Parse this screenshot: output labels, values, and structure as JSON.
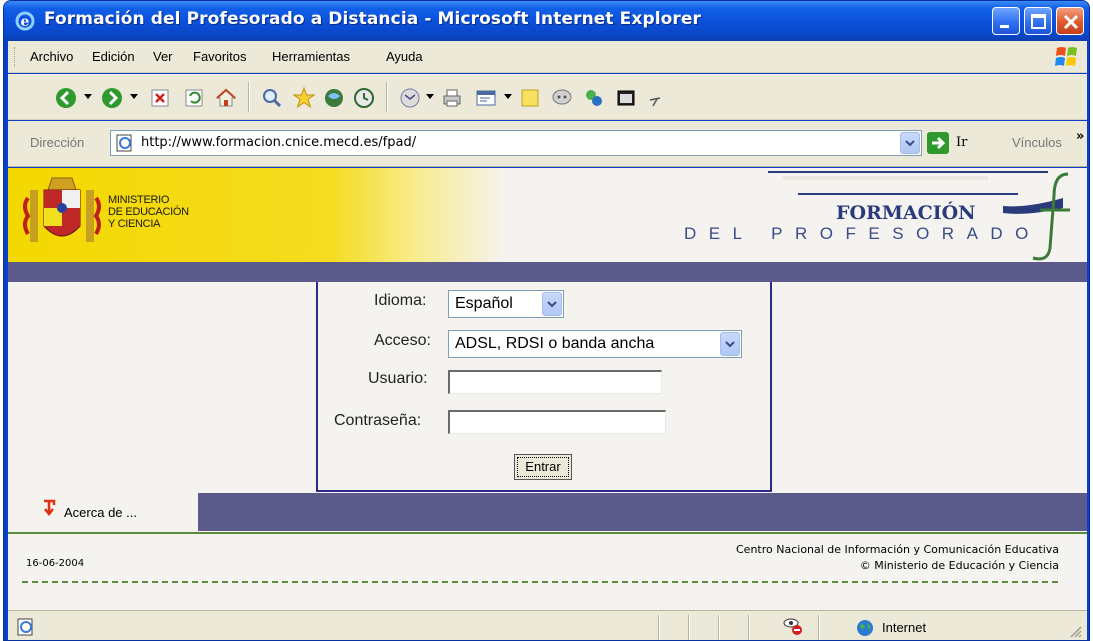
{
  "window": {
    "title": "Formación del Profesorado a Distancia - Microsoft Internet Explorer"
  },
  "menubar": {
    "items": [
      "Archivo",
      "Edición",
      "Ver",
      "Favoritos",
      "Herramientas",
      "Ayuda"
    ]
  },
  "toolbar": {
    "icons": [
      "back-icon",
      "forward-icon",
      "stop-icon",
      "refresh-icon",
      "home-icon",
      "search-icon",
      "favorites-icon",
      "media-icon",
      "history-icon",
      "mail-icon",
      "print-icon",
      "edit-icon",
      "discuss-icon",
      "messenger-icon",
      "research-icon",
      "window-icon"
    ]
  },
  "address": {
    "label": "Dirección",
    "url": "http://www.formacion.cnice.mecd.es/fpad/",
    "go_label": "Ir",
    "links_label": "Vínculos"
  },
  "header": {
    "ministerio_line1": "MINISTERIO",
    "ministerio_line2": "DE EDUCACIÓN",
    "ministerio_line3": "Y CIENCIA",
    "brand_top": "FORMACIÓN",
    "brand_bottom": "DEL PROFESORADO"
  },
  "login": {
    "idioma_label": "Idioma:",
    "idioma_value": "Español",
    "acceso_label": "Acceso:",
    "acceso_value": "ADSL, RDSI o banda ancha",
    "usuario_label": "Usuario:",
    "usuario_value": "",
    "password_label": "Contraseña:",
    "password_value": "",
    "submit_label": "Entrar"
  },
  "footer": {
    "acerca_label": "Acerca de ...",
    "date": "16-06-2004",
    "credit_line1": "Centro Nacional de Información y Comunicación Educativa",
    "credit_line2": "© Ministerio de Educación y Ciencia"
  },
  "statusbar": {
    "zone_label": "Internet"
  },
  "colors": {
    "titlebar_blue": "#0A46C8",
    "chrome_beige": "#ECE9D8",
    "band_purple": "#5C5A8A",
    "header_yellow": "#F4D800",
    "login_border": "#2C2A8A",
    "footer_green": "#5C8A3C"
  }
}
